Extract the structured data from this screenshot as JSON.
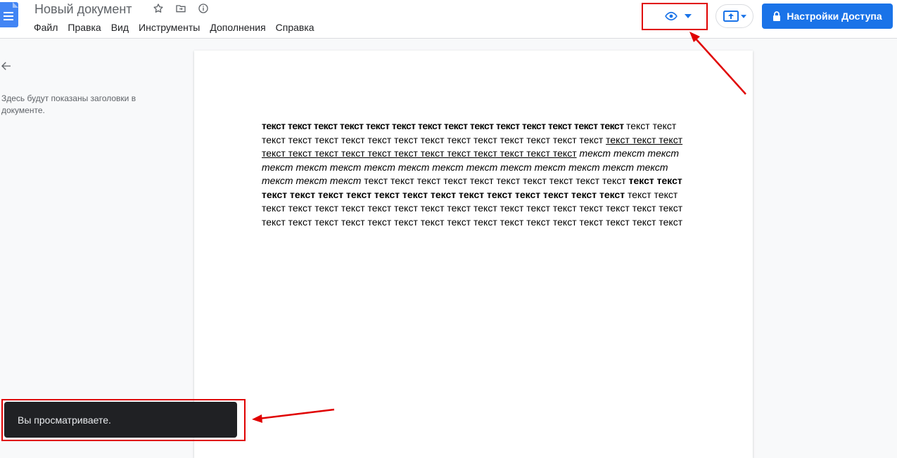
{
  "header": {
    "doc_title": "Новый документ",
    "menu": [
      "Файл",
      "Правка",
      "Вид",
      "Инструменты",
      "Дополнения",
      "Справка"
    ],
    "share_label": "Настройки Доступа"
  },
  "outline": {
    "placeholder": "Здесь будут показаны заголовки в документе."
  },
  "document": {
    "segments": [
      {
        "style": "narrow-bold",
        "text": "текст текст текст текст текст текст текст текст текст текст текст текст текст текст "
      },
      {
        "style": "normal",
        "text": "текст текст текст текст текст текст текст текст текст текст текст текст текст текст текст "
      },
      {
        "style": "underline",
        "text": "текст текст текст текст текст текст текст текст текст текст текст текст текст текст текст"
      },
      {
        "style": "normal",
        "text": " "
      },
      {
        "style": "italic",
        "text": "текст текст текст текст текст текст текст текст текст текст текст текст текст текст текст текст текст текст"
      },
      {
        "style": "normal",
        "text": " текст текст текст текст текст текст текст текст текст текст "
      },
      {
        "style": "bold",
        "text": "текст текст текст текст текст текст текст текст текст текст текст текст текст текст текст"
      },
      {
        "style": "normal",
        "text": " текст текст текст текст текст текст текст текст текст текст текст текст текст текст текст текст текст текст текст текст текст текст текст текст текст текст текст текст текст текст текст текст текст текст"
      }
    ]
  },
  "snackbar": {
    "message": "Вы просматриваете."
  }
}
